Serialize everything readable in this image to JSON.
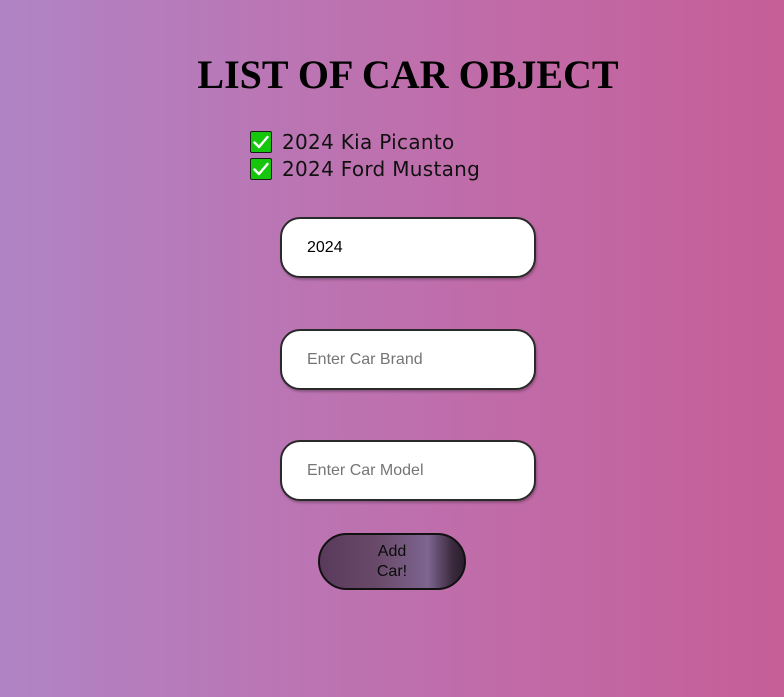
{
  "page": {
    "title": "LIST OF CAR OBJECT"
  },
  "cars": [
    {
      "text": "2024 Kia Picanto",
      "checked": true,
      "icon": "check-mark-icon"
    },
    {
      "text": "2024 Ford Mustang",
      "checked": true,
      "icon": "check-mark-icon"
    }
  ],
  "form": {
    "year": {
      "value": "2024",
      "placeholder": ""
    },
    "brand": {
      "value": "",
      "placeholder": "Enter Car Brand"
    },
    "model": {
      "value": "",
      "placeholder": "Enter Car Model"
    },
    "submit_label": "Add Car!"
  },
  "colors": {
    "check_green": "#16c60c",
    "background_left": "#b084c4",
    "background_right": "#c65e98",
    "button_base": "#5a3a5c"
  }
}
